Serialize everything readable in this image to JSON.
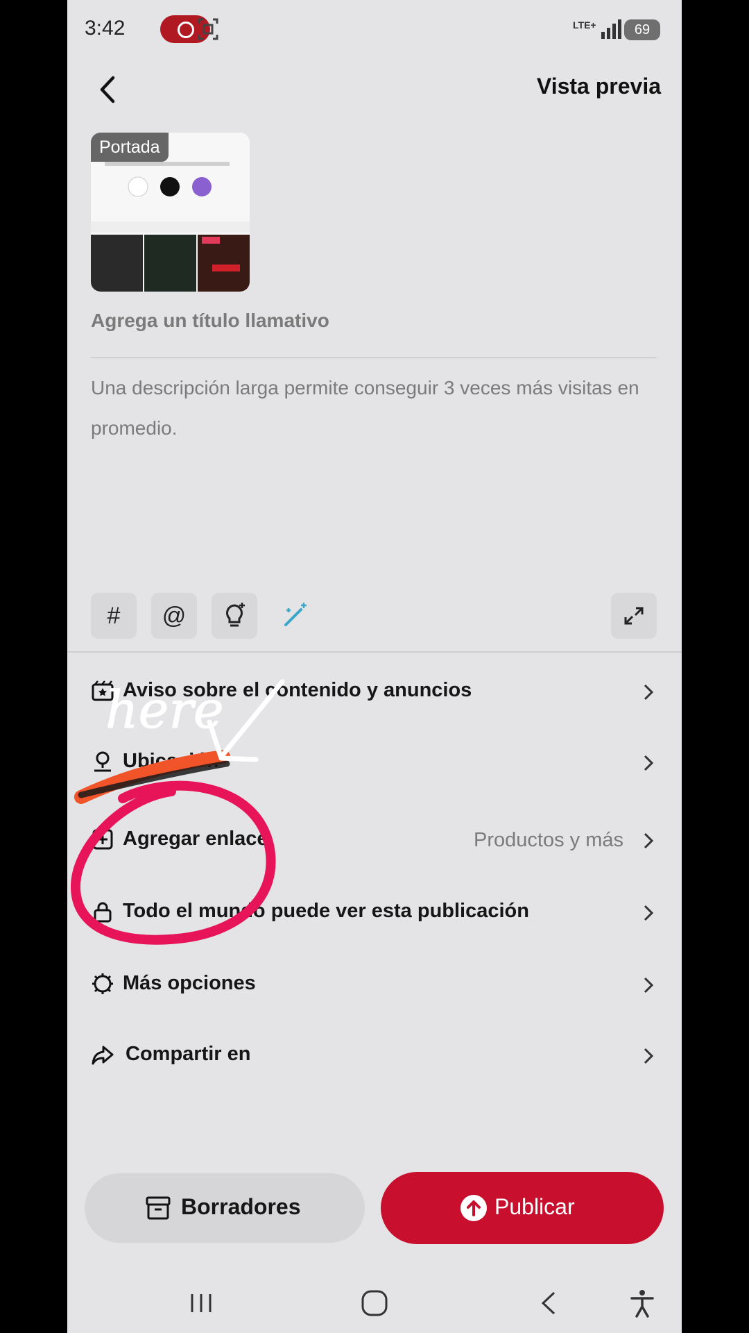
{
  "status_bar": {
    "time": "3:42",
    "network": "LTE+",
    "battery": "69"
  },
  "header": {
    "preview_label": "Vista previa"
  },
  "cover": {
    "label": "Portada"
  },
  "title_input": {
    "placeholder": "Agrega un título llamativo"
  },
  "description": {
    "placeholder": "Una descripción larga permite conseguir 3 veces más visitas en promedio."
  },
  "tools": {
    "hashtag": "#",
    "mention": "@"
  },
  "options": [
    {
      "label": "Aviso sobre el contenido y anuncios",
      "value": ""
    },
    {
      "label": "Ubicación",
      "value": ""
    },
    {
      "label": "Agregar enlace",
      "value": "Productos y más"
    },
    {
      "label": "Todo el mundo puede ver esta publicación",
      "value": ""
    },
    {
      "label": "Más opciones",
      "value": ""
    },
    {
      "label": "Compartir en",
      "value": ""
    }
  ],
  "annotation": {
    "text": "here"
  },
  "buttons": {
    "drafts": "Borradores",
    "publish": "Publicar"
  },
  "colors": {
    "accent": "#c8102e",
    "annotation_circle": "#e8145a",
    "annotation_strike": "#f2542a"
  }
}
